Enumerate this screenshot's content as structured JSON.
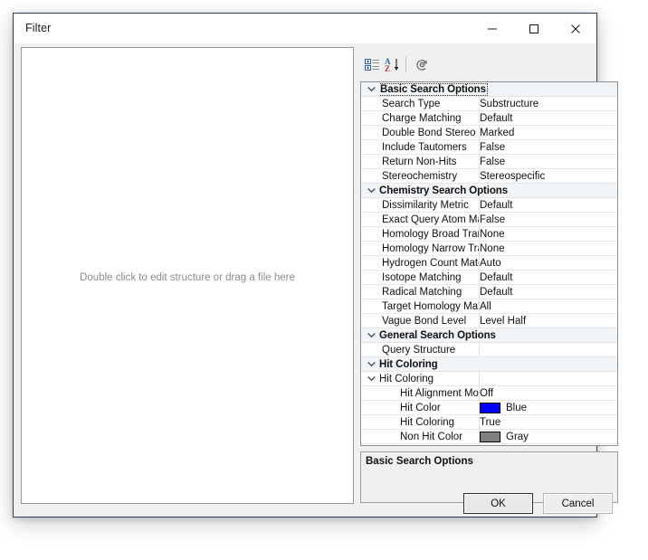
{
  "window": {
    "title": "Filter",
    "controls": [
      {
        "name": "minimize",
        "glyph": "minimize-icon"
      },
      {
        "name": "maximize",
        "glyph": "maximize-icon"
      },
      {
        "name": "close",
        "glyph": "close-icon"
      }
    ]
  },
  "structure_panel": {
    "hint": "Double click to edit structure or drag a file here"
  },
  "toolbar": {
    "buttons": [
      {
        "name": "categorized-icon",
        "tooltip": "Categorized"
      },
      {
        "name": "alphabetical-sort-icon",
        "tooltip": "Alphabetical"
      },
      {
        "name": "property-pages-icon",
        "tooltip": "Property Pages"
      }
    ]
  },
  "property_grid": {
    "rows": [
      {
        "kind": "category",
        "expander": "chevron-down-icon",
        "name": "Basic Search Options",
        "value": "",
        "focused": true
      },
      {
        "kind": "property",
        "name": "Search Type",
        "value": "Substructure"
      },
      {
        "kind": "property",
        "name": "Charge Matching",
        "value": "Default"
      },
      {
        "kind": "property",
        "name": "Double Bond Stereo Care Box Matching",
        "value": "Marked"
      },
      {
        "kind": "property",
        "name": "Include Tautomers",
        "value": "False"
      },
      {
        "kind": "property",
        "name": "Return Non-Hits",
        "value": "False"
      },
      {
        "kind": "property",
        "name": "Stereochemistry",
        "value": "Stereospecific"
      },
      {
        "kind": "category",
        "expander": "chevron-down-icon",
        "name": "Chemistry Search Options",
        "value": ""
      },
      {
        "kind": "property",
        "name": "Dissimilarity Metric",
        "value": "Default"
      },
      {
        "kind": "property",
        "name": "Exact Query Atom Matching",
        "value": "False"
      },
      {
        "kind": "property",
        "name": "Homology Broad Transform",
        "value": "None"
      },
      {
        "kind": "property",
        "name": "Homology Narrow Transform",
        "value": "None"
      },
      {
        "kind": "property",
        "name": "Hydrogen Count Matching",
        "value": "Auto"
      },
      {
        "kind": "property",
        "name": "Isotope Matching",
        "value": "Default"
      },
      {
        "kind": "property",
        "name": "Radical Matching",
        "value": "Default"
      },
      {
        "kind": "property",
        "name": "Target Homology Matching",
        "value": "All"
      },
      {
        "kind": "property",
        "name": "Vague Bond Level",
        "value": "Level Half"
      },
      {
        "kind": "category",
        "expander": "chevron-down-icon",
        "name": "General Search Options",
        "value": ""
      },
      {
        "kind": "property",
        "name": "Query Structure",
        "value": ""
      },
      {
        "kind": "category",
        "expander": "chevron-down-icon",
        "name": "Hit Coloring",
        "value": ""
      },
      {
        "kind": "subgroup",
        "expander": "chevron-down-icon",
        "name": "Hit Coloring",
        "value": ""
      },
      {
        "kind": "property2",
        "name": "Hit Alignment Mode",
        "value": "Off"
      },
      {
        "kind": "property2",
        "name": "Hit Color",
        "value": "Blue",
        "swatch": "#0000FF"
      },
      {
        "kind": "property2",
        "name": "Hit Coloring",
        "value": "True"
      },
      {
        "kind": "property2",
        "name": "Non Hit Color",
        "value": "Gray",
        "swatch": "#808080"
      }
    ]
  },
  "description_panel": {
    "title": "Basic Search Options",
    "body": ""
  },
  "buttons": {
    "ok_label": "OK",
    "cancel_label": "Cancel"
  },
  "colors": {
    "hit_color": "#0000FF",
    "non_hit_color": "#808080",
    "category_row_bg": "#f2f5f8",
    "dialog_bg": "#f0f0f0"
  }
}
